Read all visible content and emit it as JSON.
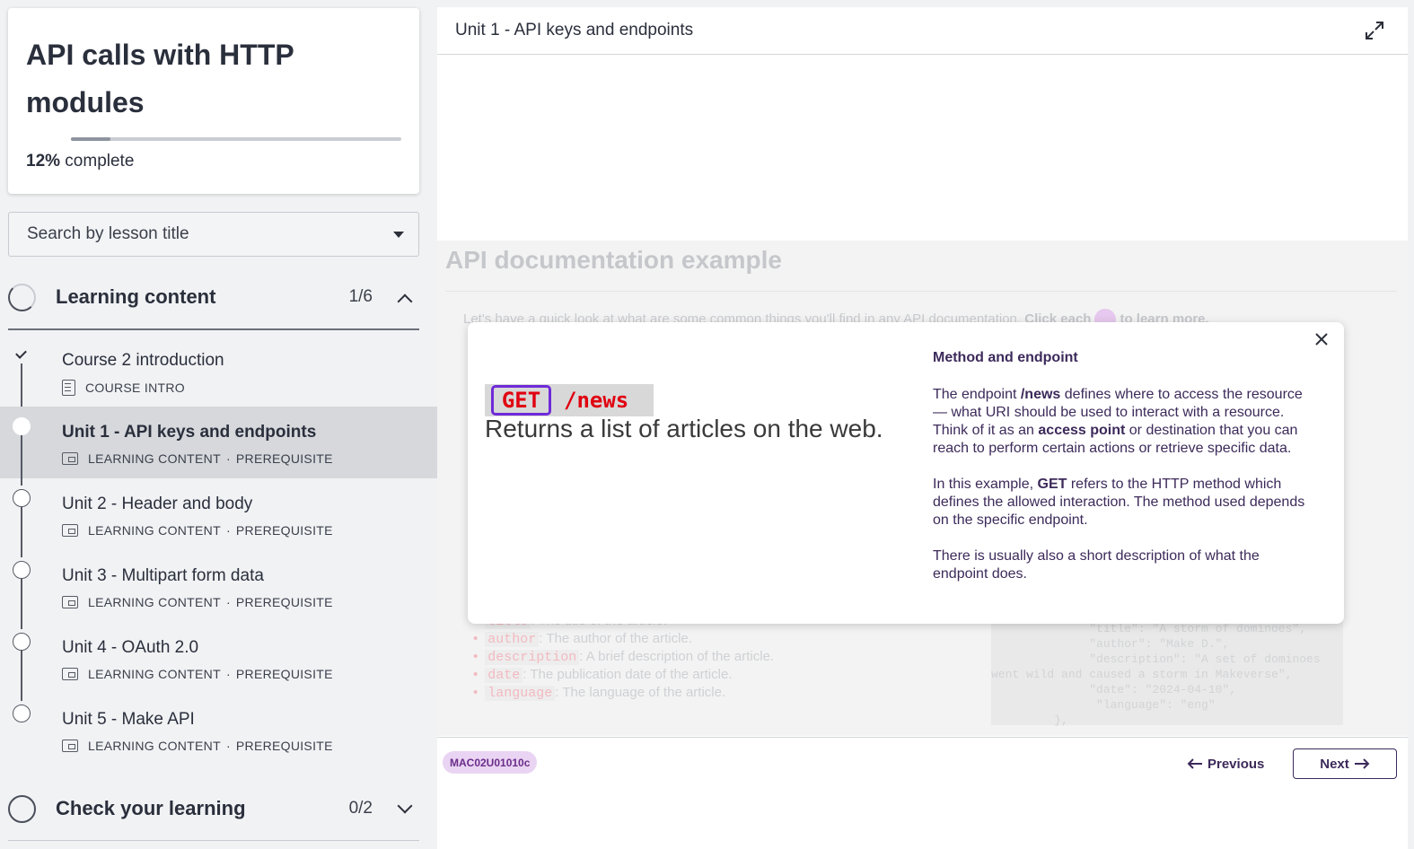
{
  "course": {
    "title": "API calls with HTTP modules",
    "progress_percent": "12%",
    "progress_fraction": 0.12,
    "progress_suffix": " complete"
  },
  "search": {
    "placeholder": "Search by lesson title"
  },
  "sections": [
    {
      "title": "Learning content",
      "count": "1/6"
    },
    {
      "title": "Check your learning",
      "count": "0/2"
    }
  ],
  "lessons": [
    {
      "title": "Course 2 introduction",
      "type": "COURSE INTRO",
      "prereq": ""
    },
    {
      "title": "Unit 1 - API keys and endpoints",
      "type": "LEARNING CONTENT",
      "prereq": "PREREQUISITE"
    },
    {
      "title": "Unit 2 - Header and body",
      "type": "LEARNING CONTENT",
      "prereq": "PREREQUISITE"
    },
    {
      "title": "Unit 3 - Multipart form data",
      "type": "LEARNING CONTENT",
      "prereq": "PREREQUISITE"
    },
    {
      "title": "Unit 4 - OAuth 2.0",
      "type": "LEARNING CONTENT",
      "prereq": "PREREQUISITE"
    },
    {
      "title": "Unit 5 - Make API",
      "type": "LEARNING CONTENT",
      "prereq": "PREREQUISITE"
    }
  ],
  "meta_separator": "·",
  "main": {
    "header_title": "Unit 1 - API keys and endpoints",
    "doc_title": "API documentation example",
    "doc_intro": "Let's have a quick look at what are some common things you'll find in any API documentation.",
    "doc_intro_cta_a": "Click each",
    "doc_intro_cta_b": "to learn more.",
    "faded_lines": [
      {
        "key": "title",
        "text": ": The title of the article."
      },
      {
        "key": "author",
        "text": ": The author of the article."
      },
      {
        "key": "description",
        "text": ": A brief description of the article."
      },
      {
        "key": "date",
        "text": ": The publication date of the article."
      },
      {
        "key": "language",
        "text": ": The language of the article."
      }
    ],
    "faded_code": [
      "              \"title\": \"A storm of dominoes\",",
      "              \"author\": \"Make D.\",",
      "              \"description\": \"A set of dominoes",
      "went wild and caused a storm in Makeverse\",",
      "              \"date\": \"2024-04-10\",",
      "               \"language\": \"eng\"",
      "         },"
    ],
    "tag": "MAC02U01010c",
    "prev_label": "Previous",
    "next_label": "Next"
  },
  "popup": {
    "method": "GET",
    "path": "/news",
    "illustration_desc": "Returns a list of articles on the web.",
    "heading": "Method and endpoint",
    "p1_a": "The endpoint ",
    "p1_b": "/news",
    "p1_c": " defines where to access the resource — what URI should be used to interact with a resource. Think of it as an ",
    "p1_d": "access point",
    "p1_e": " or destination that you can reach to perform certain actions or retrieve specific data.",
    "p2_a": "In this example, ",
    "p2_b": "GET",
    "p2_c": " refers to the HTTP method which defines the allowed interaction. The method used depends on the specific endpoint.",
    "p3": "There is usually also a short description of what the endpoint does."
  },
  "colors": {
    "accent": "#3c2a5a",
    "tag_bg": "#ead4f3",
    "method_border": "#6f2ad8",
    "endpoint_red": "#e00010"
  },
  "icons": [
    "check-icon",
    "course-intro-icon",
    "learning-content-icon",
    "expand-icon",
    "close-icon",
    "chevron-up-icon",
    "chevron-down-icon",
    "arrow-left-icon",
    "arrow-right-icon"
  ]
}
